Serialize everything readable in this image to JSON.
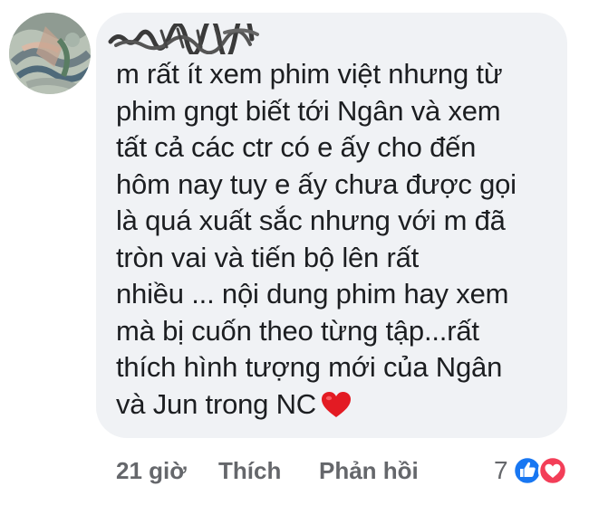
{
  "comment": {
    "text_lines": [
      "m rất ít xem phim việt nhưng từ",
      "phim gngt biết tới Ngân và xem",
      "tất cả các ctr có e ấy cho đến",
      "hôm nay tuy e ấy chưa được gọi",
      "là quá xuất sắc nhưng với m đã",
      "tròn vai và tiến bộ lên rất",
      "nhiều ... nội dung phim hay xem",
      "mà bị cuốn theo từng tập...rất",
      "thích hình tượng mới của Ngân",
      "và Jun trong NC"
    ],
    "emoji": "heart-emoji"
  },
  "actions": {
    "timestamp": "21 giờ",
    "like_label": "Thích",
    "reply_label": "Phản hồi"
  },
  "reactions": {
    "count": "7",
    "icons": [
      "like-reaction-icon",
      "love-reaction-icon"
    ]
  },
  "colors": {
    "bubble": "#f0f2f5",
    "text": "#1c1e21",
    "secondary_text": "#65676b",
    "like_blue": "#1877f2",
    "love_red": "#f33e58"
  }
}
